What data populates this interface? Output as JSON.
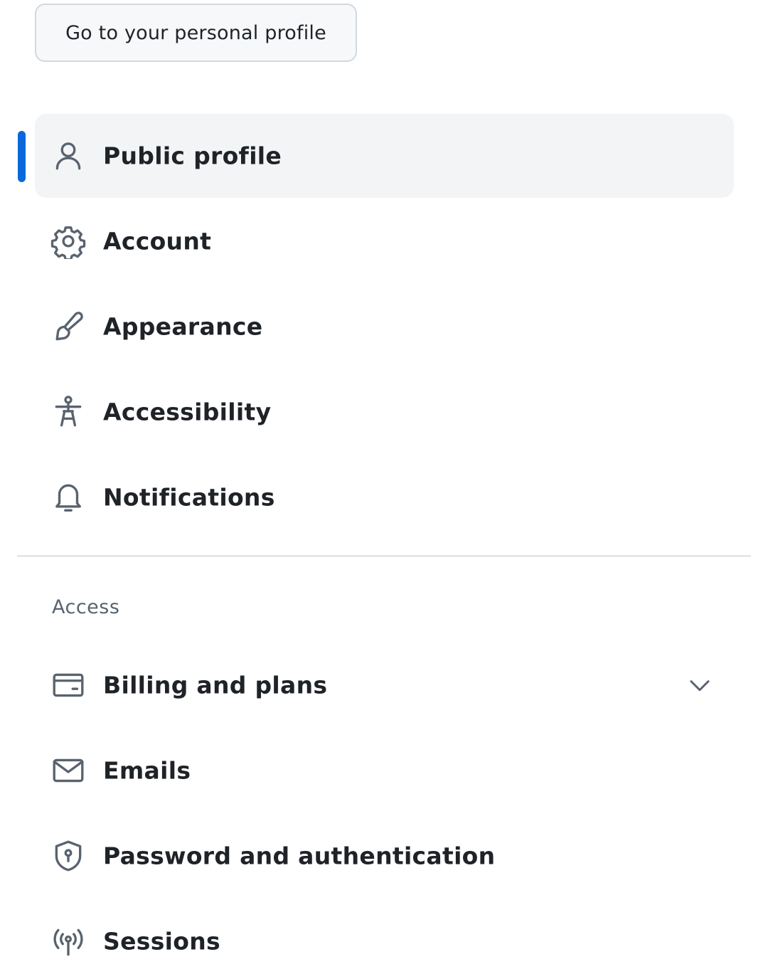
{
  "profile_button": {
    "label": "Go to your personal profile"
  },
  "nav": {
    "items": [
      {
        "label": "Public profile",
        "icon": "person-icon",
        "active": true
      },
      {
        "label": "Account",
        "icon": "gear-icon"
      },
      {
        "label": "Appearance",
        "icon": "paintbrush-icon"
      },
      {
        "label": "Accessibility",
        "icon": "accessibility-icon"
      },
      {
        "label": "Notifications",
        "icon": "bell-icon"
      }
    ]
  },
  "access": {
    "heading": "Access",
    "items": [
      {
        "label": "Billing and plans",
        "icon": "credit-card-icon",
        "expandable": true
      },
      {
        "label": "Emails",
        "icon": "mail-icon"
      },
      {
        "label": "Password and authentication",
        "icon": "shield-lock-icon"
      },
      {
        "label": "Sessions",
        "icon": "broadcast-icon"
      }
    ]
  },
  "colors": {
    "accent": "#0969da",
    "active_bg": "#f3f4f6",
    "text": "#1f2328",
    "muted": "#59636e",
    "icon": "#59636e"
  }
}
